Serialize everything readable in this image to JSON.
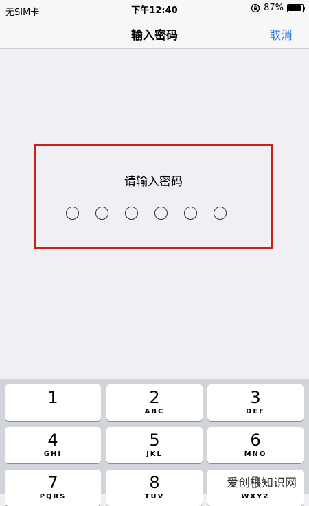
{
  "status_bar": {
    "carrier": "无SIM卡",
    "time": "下午12:40",
    "battery": "87%",
    "icons": [
      "orientation-lock-icon",
      "battery-icon"
    ]
  },
  "nav": {
    "title": "输入密码",
    "cancel": "取消"
  },
  "passcode": {
    "prompt": "请输入密码",
    "digit_count": 6,
    "entered": 0,
    "highlight_color": "#c8221b"
  },
  "keypad": {
    "keys": [
      {
        "digit": "1",
        "letters": ""
      },
      {
        "digit": "2",
        "letters": "ABC"
      },
      {
        "digit": "3",
        "letters": "DEF"
      },
      {
        "digit": "4",
        "letters": "GHI"
      },
      {
        "digit": "5",
        "letters": "JKL"
      },
      {
        "digit": "6",
        "letters": "MNO"
      },
      {
        "digit": "7",
        "letters": "PQRS"
      },
      {
        "digit": "8",
        "letters": "TUV"
      },
      {
        "digit": "9",
        "letters": "WXYZ"
      }
    ]
  },
  "watermark": "爱创根知识网",
  "colors": {
    "accent": "#2f80ed",
    "background": "#efeff4",
    "keypad_bg": "#d1d4d9"
  }
}
